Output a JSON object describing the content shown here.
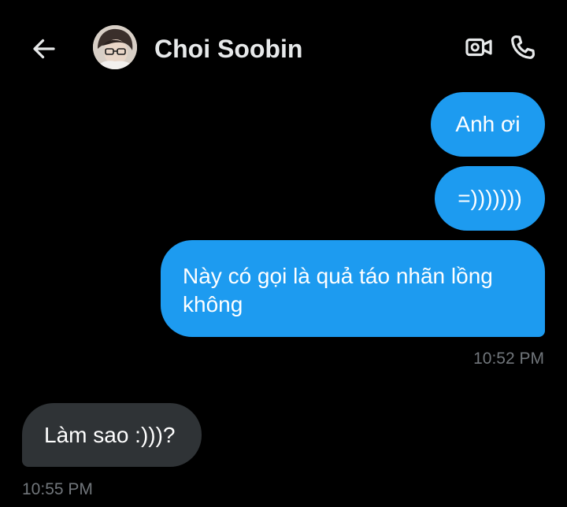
{
  "header": {
    "contact_name": "Choi Soobin",
    "back_icon": "arrow-left-icon",
    "video_icon": "video-camera-icon",
    "call_icon": "phone-icon"
  },
  "messages": [
    {
      "direction": "outgoing",
      "text": "Anh ơi"
    },
    {
      "direction": "outgoing",
      "text": "=)))))))"
    },
    {
      "direction": "outgoing",
      "text": "Này có gọi là quả táo nhãn lồng không"
    },
    {
      "direction": "incoming",
      "text": "Làm sao :)))?"
    }
  ],
  "timestamps": {
    "outgoing_group": "10:52 PM",
    "incoming_group": "10:55 PM"
  },
  "colors": {
    "background": "#000000",
    "outgoing_bubble": "#1d9bf0",
    "incoming_bubble": "#2f3336",
    "timestamp": "#71767b",
    "text": "#e7e9ea"
  }
}
